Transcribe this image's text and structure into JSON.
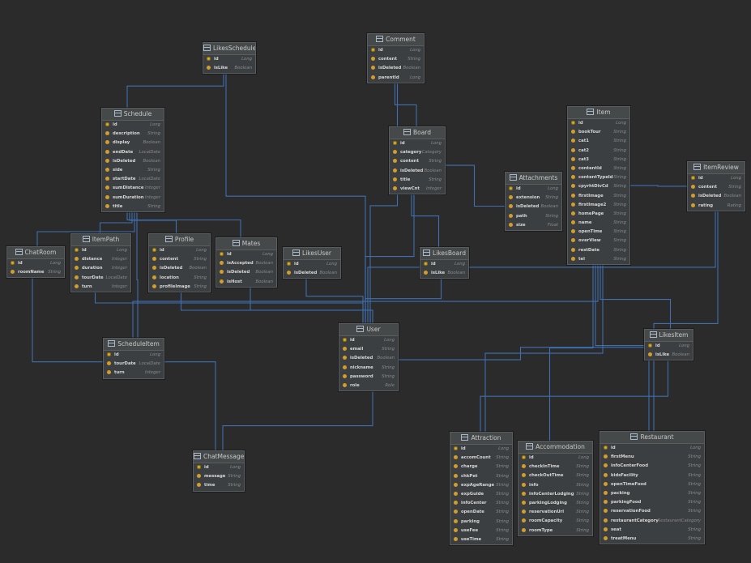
{
  "entities": [
    {
      "key": "likesschedule",
      "name": "LikesSchedule",
      "fields": [
        {
          "name": "id",
          "type": "Long",
          "pk": true
        },
        {
          "name": "isLike",
          "type": "Boolean"
        }
      ]
    },
    {
      "key": "comment",
      "name": "Comment",
      "fields": [
        {
          "name": "id",
          "type": "Long",
          "pk": true
        },
        {
          "name": "content",
          "type": "String"
        },
        {
          "name": "isDeleted",
          "type": "Boolean"
        },
        {
          "name": "parentId",
          "type": "Long"
        }
      ]
    },
    {
      "key": "schedule",
      "name": "Schedule",
      "fields": [
        {
          "name": "id",
          "type": "Long",
          "pk": true
        },
        {
          "name": "description",
          "type": "String"
        },
        {
          "name": "display",
          "type": "Boolean"
        },
        {
          "name": "endDate",
          "type": "LocalDate"
        },
        {
          "name": "isDeleted",
          "type": "Boolean"
        },
        {
          "name": "side",
          "type": "String"
        },
        {
          "name": "startDate",
          "type": "LocalDate"
        },
        {
          "name": "sumDistance",
          "type": "Integer"
        },
        {
          "name": "sumDuration",
          "type": "Integer"
        },
        {
          "name": "title",
          "type": "String"
        }
      ]
    },
    {
      "key": "board",
      "name": "Board",
      "fields": [
        {
          "name": "id",
          "type": "Long",
          "pk": true
        },
        {
          "name": "category",
          "type": "Category"
        },
        {
          "name": "content",
          "type": "String"
        },
        {
          "name": "isDeleted",
          "type": "Boolean"
        },
        {
          "name": "title",
          "type": "String"
        },
        {
          "name": "viewCnt",
          "type": "Integer"
        }
      ]
    },
    {
      "key": "item",
      "name": "Item",
      "fields": [
        {
          "name": "id",
          "type": "Long",
          "pk": true
        },
        {
          "name": "bookTour",
          "type": "String"
        },
        {
          "name": "cat1",
          "type": "String"
        },
        {
          "name": "cat2",
          "type": "String"
        },
        {
          "name": "cat3",
          "type": "String"
        },
        {
          "name": "contentId",
          "type": "String"
        },
        {
          "name": "contentTypeId",
          "type": "String"
        },
        {
          "name": "cpyrhtDivCd",
          "type": "String"
        },
        {
          "name": "firstImage",
          "type": "String"
        },
        {
          "name": "firstImage2",
          "type": "String"
        },
        {
          "name": "homePage",
          "type": "String"
        },
        {
          "name": "name",
          "type": "String"
        },
        {
          "name": "openTime",
          "type": "String"
        },
        {
          "name": "overView",
          "type": "String"
        },
        {
          "name": "restDate",
          "type": "String"
        },
        {
          "name": "tel",
          "type": "String"
        }
      ]
    },
    {
      "key": "attachments",
      "name": "Attachments",
      "fields": [
        {
          "name": "id",
          "type": "Long",
          "pk": true
        },
        {
          "name": "extension",
          "type": "String"
        },
        {
          "name": "isDeleted",
          "type": "Boolean"
        },
        {
          "name": "path",
          "type": "String"
        },
        {
          "name": "size",
          "type": "Float"
        }
      ]
    },
    {
      "key": "itemreview",
      "name": "ItemReview",
      "fields": [
        {
          "name": "id",
          "type": "Long",
          "pk": true
        },
        {
          "name": "content",
          "type": "String"
        },
        {
          "name": "isDeleted",
          "type": "Boolean"
        },
        {
          "name": "rating",
          "type": "Rating"
        }
      ]
    },
    {
      "key": "chatroom",
      "name": "ChatRoom",
      "fields": [
        {
          "name": "id",
          "type": "Long",
          "pk": true
        },
        {
          "name": "roomName",
          "type": "String"
        }
      ]
    },
    {
      "key": "itempath",
      "name": "ItemPath",
      "fields": [
        {
          "name": "id",
          "type": "Long",
          "pk": true
        },
        {
          "name": "distance",
          "type": "Integer"
        },
        {
          "name": "duration",
          "type": "Integer"
        },
        {
          "name": "tourDate",
          "type": "LocalDate"
        },
        {
          "name": "turn",
          "type": "Integer"
        }
      ]
    },
    {
      "key": "profile",
      "name": "Profile",
      "fields": [
        {
          "name": "id",
          "type": "Long",
          "pk": true
        },
        {
          "name": "content",
          "type": "String"
        },
        {
          "name": "isDeleted",
          "type": "Boolean"
        },
        {
          "name": "location",
          "type": "String"
        },
        {
          "name": "profileImage",
          "type": "String"
        }
      ]
    },
    {
      "key": "mates",
      "name": "Mates",
      "fields": [
        {
          "name": "id",
          "type": "Long",
          "pk": true
        },
        {
          "name": "isAccepted",
          "type": "Boolean"
        },
        {
          "name": "isDeleted",
          "type": "Boolean"
        },
        {
          "name": "isHost",
          "type": "Boolean"
        }
      ]
    },
    {
      "key": "likesuser",
      "name": "LikesUser",
      "fields": [
        {
          "name": "id",
          "type": "Long",
          "pk": true
        },
        {
          "name": "isDeleted",
          "type": "Boolean"
        }
      ]
    },
    {
      "key": "likesboard",
      "name": "LikesBoard",
      "fields": [
        {
          "name": "id",
          "type": "Long",
          "pk": true
        },
        {
          "name": "isLike",
          "type": "Boolean"
        }
      ]
    },
    {
      "key": "user",
      "name": "User",
      "fields": [
        {
          "name": "id",
          "type": "Long",
          "pk": true
        },
        {
          "name": "email",
          "type": "String"
        },
        {
          "name": "isDeleted",
          "type": "Boolean"
        },
        {
          "name": "nickname",
          "type": "String"
        },
        {
          "name": "password",
          "type": "String"
        },
        {
          "name": "role",
          "type": "Role"
        }
      ]
    },
    {
      "key": "likesitem",
      "name": "LikesItem",
      "fields": [
        {
          "name": "id",
          "type": "Long",
          "pk": true
        },
        {
          "name": "isLike",
          "type": "Boolean"
        }
      ]
    },
    {
      "key": "scheduleitem",
      "name": "ScheduleItem",
      "fields": [
        {
          "name": "id",
          "type": "Long",
          "pk": true
        },
        {
          "name": "tourDate",
          "type": "LocalDate"
        },
        {
          "name": "turn",
          "type": "Integer"
        }
      ]
    },
    {
      "key": "chatmessage",
      "name": "ChatMessage",
      "fields": [
        {
          "name": "id",
          "type": "Long",
          "pk": true
        },
        {
          "name": "message",
          "type": "String"
        },
        {
          "name": "time",
          "type": "String"
        }
      ]
    },
    {
      "key": "attraction",
      "name": "Attraction",
      "fields": [
        {
          "name": "id",
          "type": "Long",
          "pk": true
        },
        {
          "name": "accomCount",
          "type": "String"
        },
        {
          "name": "charge",
          "type": "String"
        },
        {
          "name": "chkPet",
          "type": "String"
        },
        {
          "name": "expAgeRange",
          "type": "String"
        },
        {
          "name": "expGuide",
          "type": "String"
        },
        {
          "name": "infoCenter",
          "type": "String"
        },
        {
          "name": "openDate",
          "type": "String"
        },
        {
          "name": "parking",
          "type": "String"
        },
        {
          "name": "useFee",
          "type": "String"
        },
        {
          "name": "useTime",
          "type": "String"
        }
      ]
    },
    {
      "key": "accommodation",
      "name": "Accommodation",
      "fields": [
        {
          "name": "id",
          "type": "Long",
          "pk": true
        },
        {
          "name": "checkInTime",
          "type": "String"
        },
        {
          "name": "checkOutTime",
          "type": "String"
        },
        {
          "name": "info",
          "type": "String"
        },
        {
          "name": "infoCenterLodging",
          "type": "String"
        },
        {
          "name": "parkingLodging",
          "type": "String"
        },
        {
          "name": "reservationUrl",
          "type": "String"
        },
        {
          "name": "roomCapacity",
          "type": "String"
        },
        {
          "name": "roomType",
          "type": "String"
        }
      ]
    },
    {
      "key": "restaurant",
      "name": "Restaurant",
      "fields": [
        {
          "name": "id",
          "type": "Long",
          "pk": true
        },
        {
          "name": "firstMenu",
          "type": "String"
        },
        {
          "name": "infoCenterFood",
          "type": "String"
        },
        {
          "name": "kidsFacility",
          "type": "String"
        },
        {
          "name": "openTimeFood",
          "type": "String"
        },
        {
          "name": "packing",
          "type": "String"
        },
        {
          "name": "parkingFood",
          "type": "String"
        },
        {
          "name": "reservationFood",
          "type": "String"
        },
        {
          "name": "restaurantCategory",
          "type": "RestaurantCategory"
        },
        {
          "name": "seat",
          "type": "String"
        },
        {
          "name": "treatMenu",
          "type": "String"
        }
      ]
    }
  ],
  "relations": [
    [
      "likesschedule",
      "schedule"
    ],
    [
      "likesschedule",
      "user"
    ],
    [
      "comment",
      "board"
    ],
    [
      "comment",
      "user"
    ],
    [
      "board",
      "attachments"
    ],
    [
      "board",
      "likesboard"
    ],
    [
      "board",
      "user"
    ],
    [
      "schedule",
      "itempath"
    ],
    [
      "schedule",
      "chatroom"
    ],
    [
      "schedule",
      "scheduleitem"
    ],
    [
      "schedule",
      "mates"
    ],
    [
      "schedule",
      "profile"
    ],
    [
      "item",
      "itemreview"
    ],
    [
      "item",
      "likesitem"
    ],
    [
      "item",
      "attraction"
    ],
    [
      "item",
      "accommodation"
    ],
    [
      "item",
      "restaurant"
    ],
    [
      "item",
      "scheduleitem"
    ],
    [
      "user",
      "profile"
    ],
    [
      "user",
      "mates"
    ],
    [
      "user",
      "likesuser"
    ],
    [
      "user",
      "likesboard"
    ],
    [
      "user",
      "itemreview"
    ],
    [
      "user",
      "likesitem"
    ],
    [
      "user",
      "chatmessage"
    ],
    [
      "user",
      "itempath"
    ],
    [
      "chatroom",
      "chatmessage"
    ],
    [
      "likesitem",
      "attraction"
    ],
    [
      "itemreview",
      "restaurant"
    ]
  ]
}
